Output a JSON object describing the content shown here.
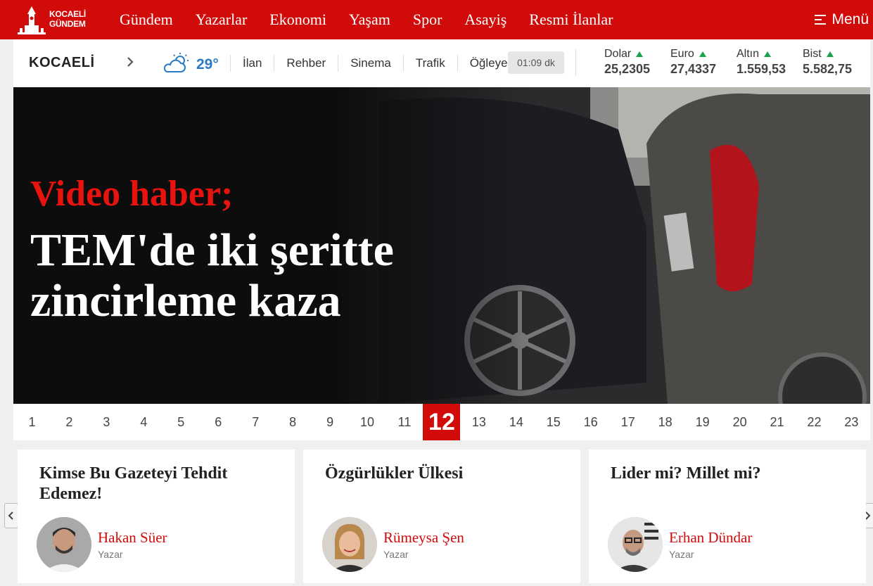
{
  "brand": {
    "line1": "KOCAELİ",
    "line2": "GÜNDEM"
  },
  "nav": {
    "links": [
      "Gündem",
      "Yazarlar",
      "Ekonomi",
      "Yaşam",
      "Spor",
      "Asayiş",
      "Resmi İlanlar"
    ],
    "menu_label": "Menü"
  },
  "infobar": {
    "city": "KOCAELİ",
    "temperature": "29°",
    "links": [
      "İlan",
      "Rehber",
      "Sinema",
      "Trafik"
    ],
    "prayer_label": "Öğleye",
    "prayer_time": "01:09 dk",
    "currencies": [
      {
        "name": "Dolar",
        "value": "25,2305",
        "trend": "up"
      },
      {
        "name": "Euro",
        "value": "27,4337",
        "trend": "up"
      },
      {
        "name": "Altın",
        "value": "1.559,53",
        "trend": "up"
      },
      {
        "name": "Bist",
        "value": "5.582,75",
        "trend": "up"
      }
    ],
    "trend_color": "#1aa34a"
  },
  "hero": {
    "kicker": "Video haber;",
    "title": "TEM'de iki şeritte zincirleme kaza"
  },
  "pager": {
    "pages": [
      "1",
      "2",
      "3",
      "4",
      "5",
      "6",
      "7",
      "8",
      "9",
      "10",
      "11",
      "12",
      "13",
      "14",
      "15",
      "16",
      "17",
      "18",
      "19",
      "20",
      "21",
      "22",
      "23"
    ],
    "active": "12"
  },
  "columns": [
    {
      "title": "Kimse Bu Gazeteyi Tehdit Edemez!",
      "author": "Hakan Süer",
      "role": "Yazar"
    },
    {
      "title": "Özgürlükler Ülkesi",
      "author": "Rümeysa Şen",
      "role": "Yazar"
    },
    {
      "title": "Lider mi? Millet mi?",
      "author": "Erhan Dündar",
      "role": "Yazar"
    }
  ],
  "colors": {
    "brand_red": "#d10a0a",
    "kicker_red": "#e8130e",
    "temp_blue": "#2a7bc4"
  }
}
